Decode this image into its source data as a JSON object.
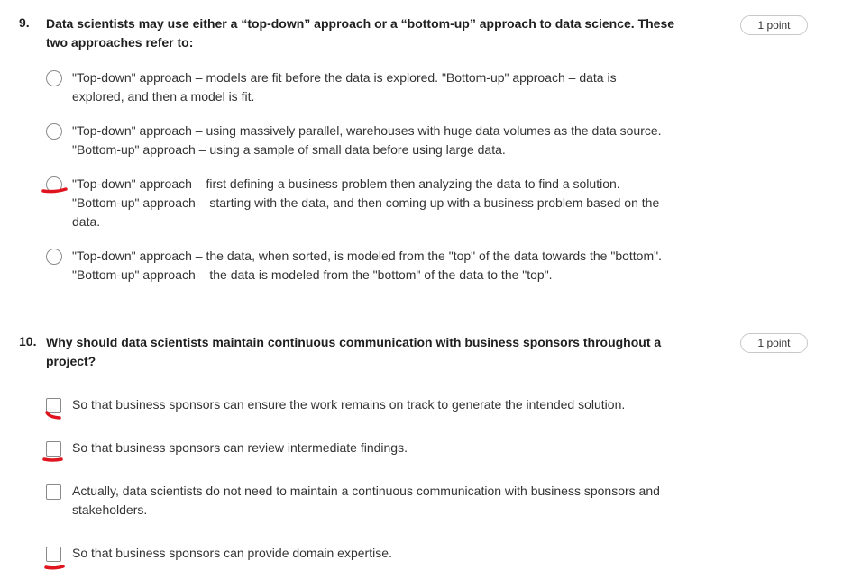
{
  "questions": [
    {
      "number": "9.",
      "text": "Data scientists may use either a “top-down” approach or a “bottom-up” approach to data science. These two approaches refer to:",
      "points": "1 point",
      "type": "radio",
      "options": [
        {
          "text": "\"Top-down\" approach – models are fit before the data is explored. \"Bottom-up\" approach – data is explored, and then a model is fit."
        },
        {
          "text": "\"Top-down\" approach – using massively parallel, warehouses with huge data volumes as the data source. \"Bottom-up\" approach – using a sample of small data before using large data."
        },
        {
          "text": "\"Top-down\" approach – first defining a business problem then analyzing the data to find a solution. \"Bottom-up\" approach – starting with the data, and then coming up with a business problem based on the data."
        },
        {
          "text": "\"Top-down\" approach – the data, when sorted, is modeled from the \"top\" of the data towards the \"bottom\". \"Bottom-up\" approach – the data is modeled from the \"bottom\" of the data to the \"top\"."
        }
      ]
    },
    {
      "number": "10.",
      "text": "Why should data scientists maintain continuous communication with business sponsors throughout a project?",
      "points": "1 point",
      "type": "checkbox",
      "options": [
        {
          "text": "So that business sponsors can ensure the work remains on track to generate the intended solution."
        },
        {
          "text": "So that business sponsors can review intermediate findings."
        },
        {
          "text": "Actually, data scientists do not need to maintain a continuous communication with business sponsors and stakeholders."
        },
        {
          "text": "So that business sponsors can provide domain expertise."
        }
      ]
    }
  ],
  "colors": {
    "annotation": "#e0141e",
    "control_border": "#8a8a8a"
  }
}
